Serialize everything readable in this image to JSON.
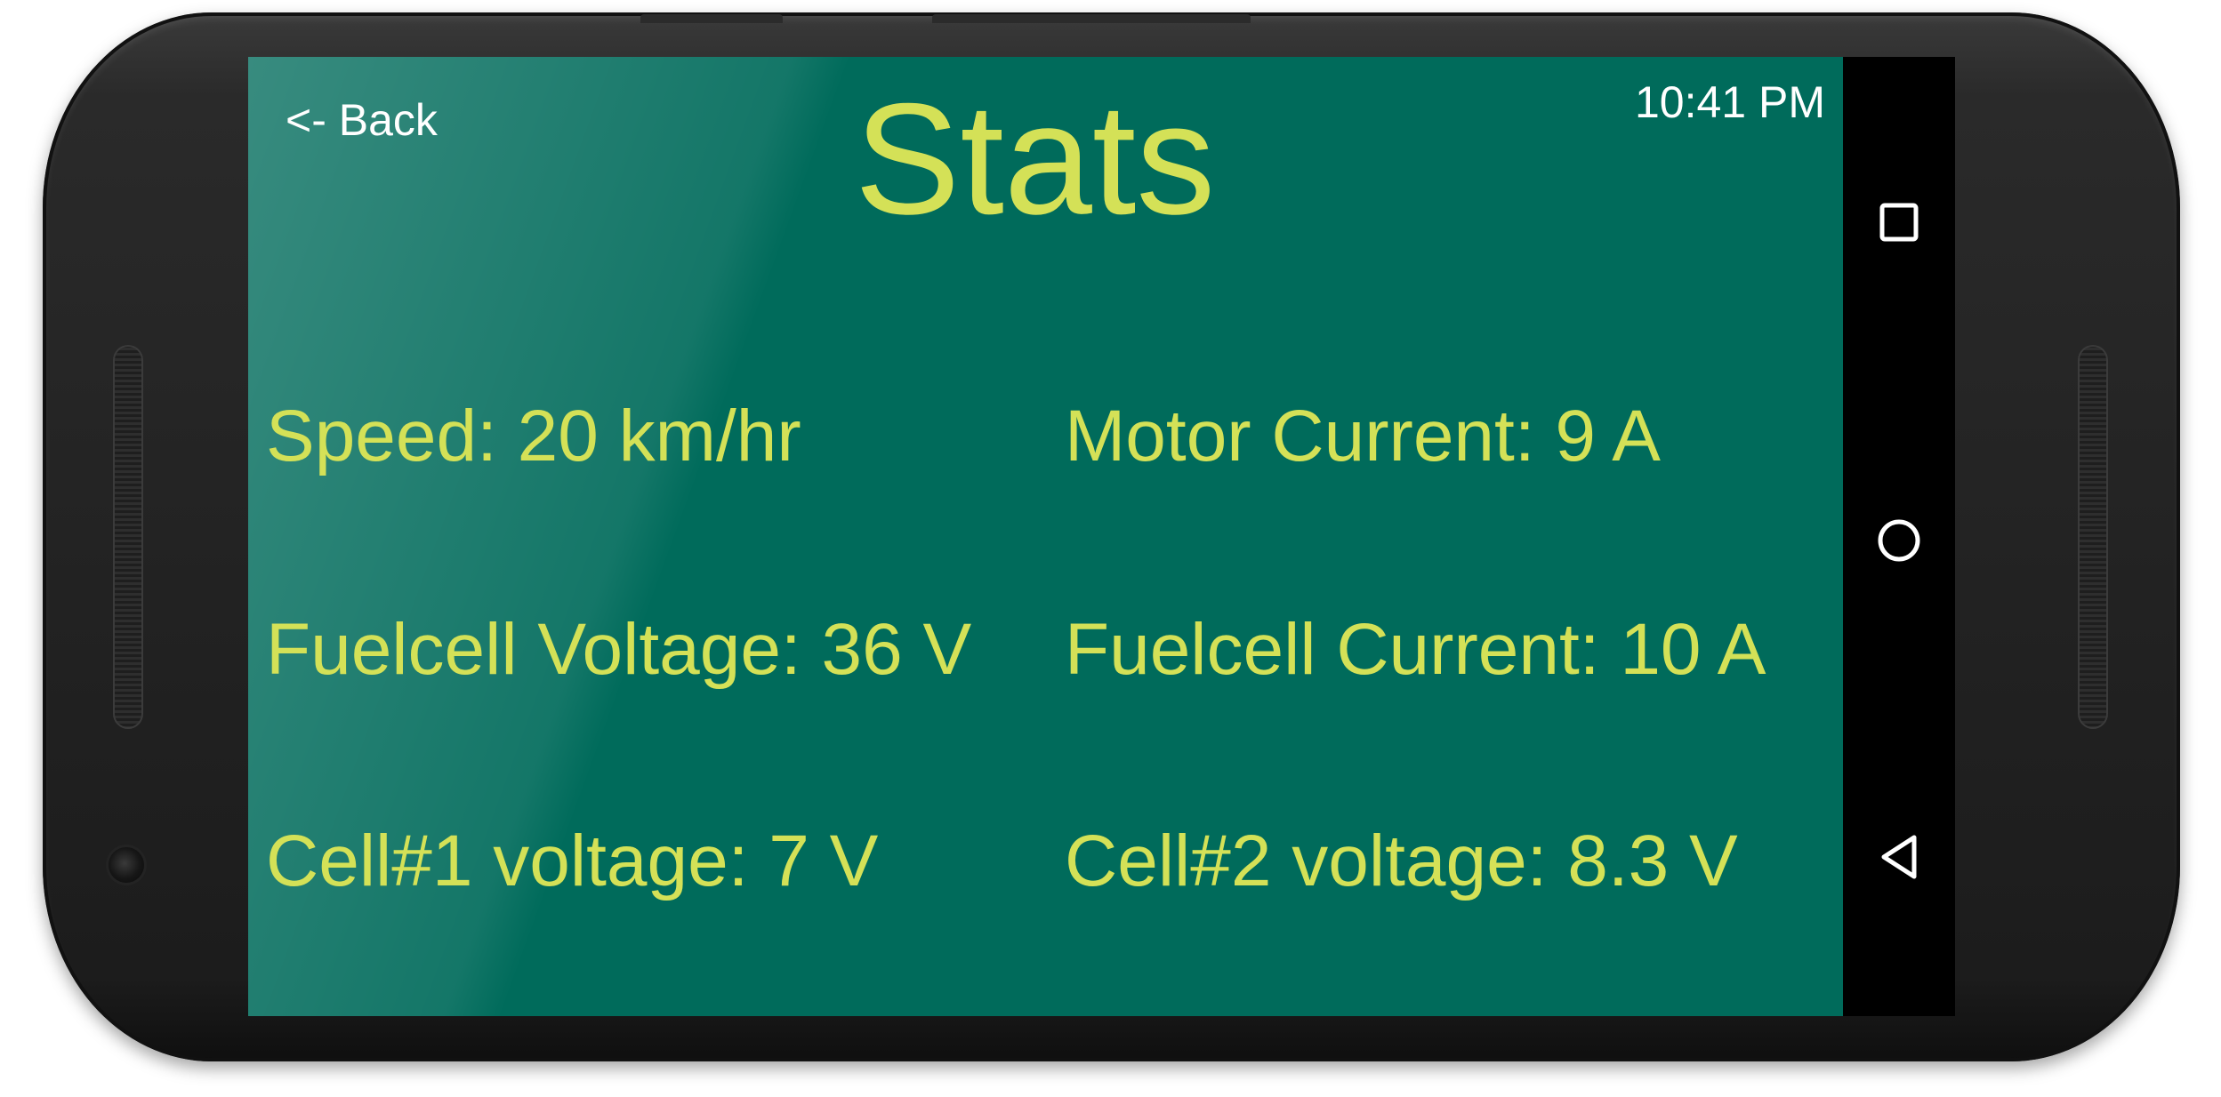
{
  "app": {
    "back_label": "<- Back",
    "time": "10:41 PM",
    "title": "Stats"
  },
  "stats": {
    "speed": "Speed: 20 km/hr",
    "motor_current": "Motor Current: 9 A",
    "fuelcell_voltage": "Fuelcell Voltage: 36 V",
    "fuelcell_current": "Fuelcell Current: 10 A",
    "cell1_voltage": "Cell#1 voltage: 7 V",
    "cell2_voltage": "Cell#2 voltage: 8.3 V"
  },
  "navbar": {
    "icons": [
      "square-recents-icon",
      "circle-home-icon",
      "triangle-back-icon"
    ]
  },
  "colors": {
    "screen_bg": "#006b5b",
    "accent_text": "#d4e157",
    "header_text": "#ffffff",
    "navbar_bg": "#000000"
  }
}
